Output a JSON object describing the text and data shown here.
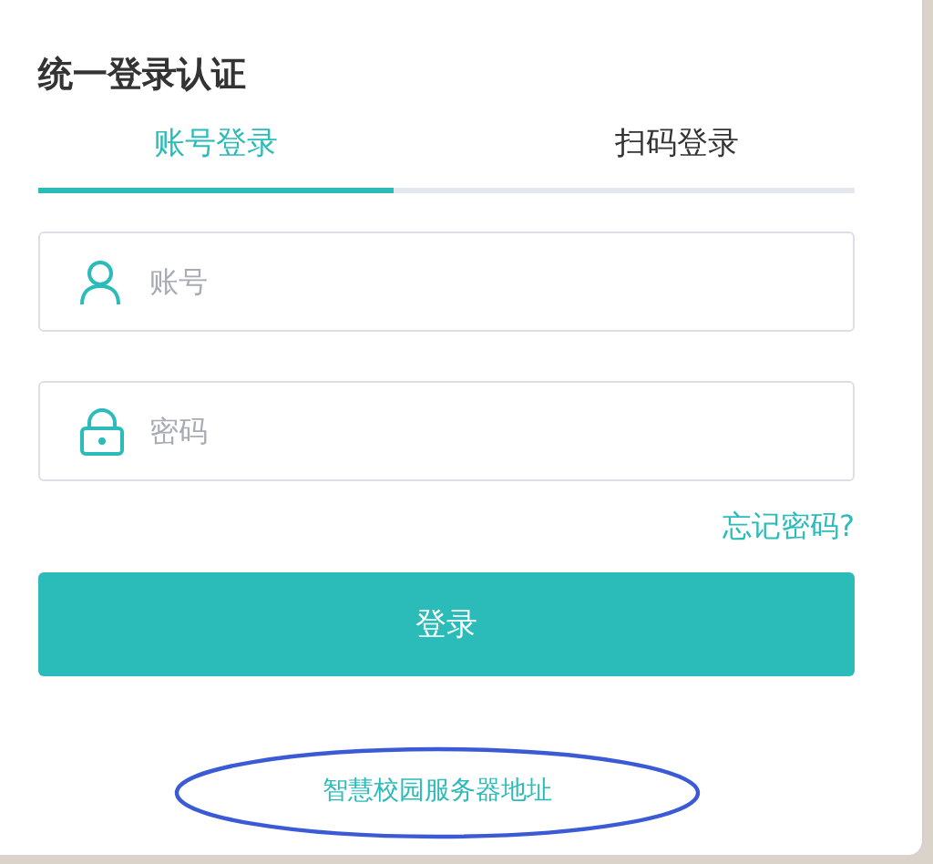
{
  "title": "统一登录认证",
  "tabs": [
    {
      "label": "账号登录",
      "selected": true
    },
    {
      "label": "扫码登录",
      "selected": false
    }
  ],
  "fields": [
    {
      "kind": "user",
      "placeholder": "账号"
    },
    {
      "kind": "lock",
      "placeholder": "密码"
    }
  ],
  "forgot_link": "忘记密码?",
  "login_button": "登录",
  "server_link": "智慧校园服务器地址"
}
